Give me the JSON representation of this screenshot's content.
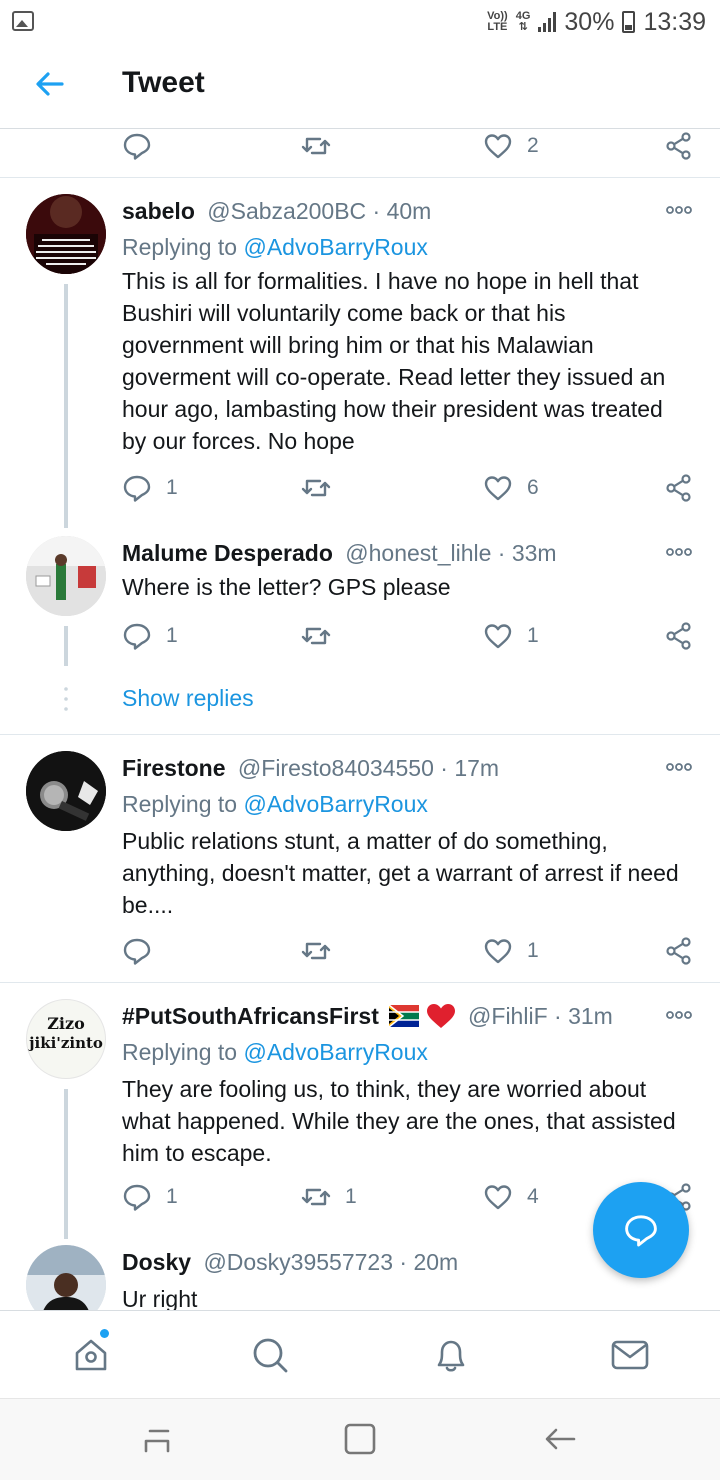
{
  "status_bar": {
    "volte": "Vo))",
    "lte": "LTE",
    "network": "4G",
    "battery": "30%",
    "time": "13:39"
  },
  "header": {
    "title": "Tweet",
    "accent_color": "#1da1f2"
  },
  "top_actions": {
    "likes": "2"
  },
  "tweets": [
    {
      "name": "sabelo",
      "handle": "@Sabza200BC",
      "time": "· 40m",
      "replying_prefix": "Replying to",
      "replying_to": "@AdvoBarryRoux",
      "avatar_text": "\"DEATH IS NOT THE GREATEST LOSS IN LIFE. THE GREATEST LOSS IS WHAT DIES INSIDE WHILE STILL ALIVE.\"",
      "body": "This is all for formalities. I have no hope in hell that Bushiri will voluntarily come back or that his government will bring him or that his Malawian goverment will co-operate. Read letter they issued an hour ago, lambasting how their president was treated by our forces. No hope",
      "replies": "1",
      "retweets": "",
      "likes": "6"
    },
    {
      "name": "Malume Desperado",
      "handle": "@honest_lihle",
      "time": "· 33m",
      "body": "Where is the letter? GPS please",
      "replies": "1",
      "retweets": "",
      "likes": "1"
    },
    {
      "name": "Firestone",
      "handle": "@Firesto84034550",
      "time": "· 17m",
      "replying_prefix": "Replying to",
      "replying_to": "@AdvoBarryRoux",
      "body": "Public relations stunt, a matter of do something, anything,  doesn't matter, get a warrant of arrest if need be....",
      "replies": "",
      "retweets": "",
      "likes": "1"
    },
    {
      "name": "#PutSouthAfricansFirst",
      "handle": "@FihliF",
      "time": "· 31m",
      "replying_prefix": "Replying to",
      "replying_to": "@AdvoBarryRoux",
      "avatar_line1": "Zizo",
      "avatar_line2": "jiki'zinto",
      "body": "They are fooling us, to think, they are worried about what happened. While they are the ones, that assisted him to escape.",
      "replies": "1",
      "retweets": "1",
      "likes": "4"
    },
    {
      "name": "Dosky",
      "handle": "@Dosky39557723",
      "time": "· 20m",
      "body": "Ur right"
    }
  ],
  "show_replies": "Show replies",
  "bottom_nav": [
    "home-icon",
    "search-icon",
    "notifications-icon",
    "messages-icon"
  ]
}
